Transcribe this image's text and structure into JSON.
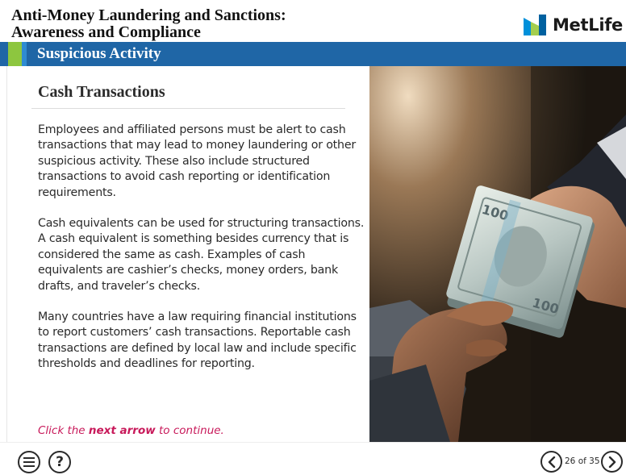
{
  "header": {
    "course_title_line1": "Anti-Money Laundering and Sanctions:",
    "course_title_line2": "Awareness and Compliance",
    "logo_text": "MetLife",
    "logo_colors": [
      "#0090da",
      "#a4ce4e",
      "#0061a0"
    ]
  },
  "section": {
    "title": "Suspicious Activity",
    "bar_color": "#1f66a6",
    "accent_color": "#8dc63f"
  },
  "content": {
    "title": "Cash Transactions",
    "paragraphs": [
      "Employees and affiliated persons must be alert to cash transactions that may lead to money laundering or other suspicious activity. These also include structured transactions to avoid cash reporting or identification requirements.",
      "Cash equivalents can be used for structuring transactions. A cash equivalent is something besides currency that is considered the same as cash. Examples of cash equivalents are cashier’s checks, money orders, bank drafts, and traveler’s checks.",
      "Many countries have a law requiring financial institutions to report customers’ cash transactions. Reportable cash transactions are defined by local law and include specific thresholds and deadlines for reporting."
    ],
    "cta_prefix": "Click the ",
    "cta_bold": "next arrow",
    "cta_suffix": " to continue.",
    "cta_color": "#c8195a"
  },
  "image": {
    "icon": "photo-hands-exchanging-cash"
  },
  "footer": {
    "menu_icon": "menu-icon",
    "help_label": "?",
    "prev_icon": "chevron-left-icon",
    "next_icon": "chevron-right-icon",
    "page_counter": "26 of 35"
  }
}
